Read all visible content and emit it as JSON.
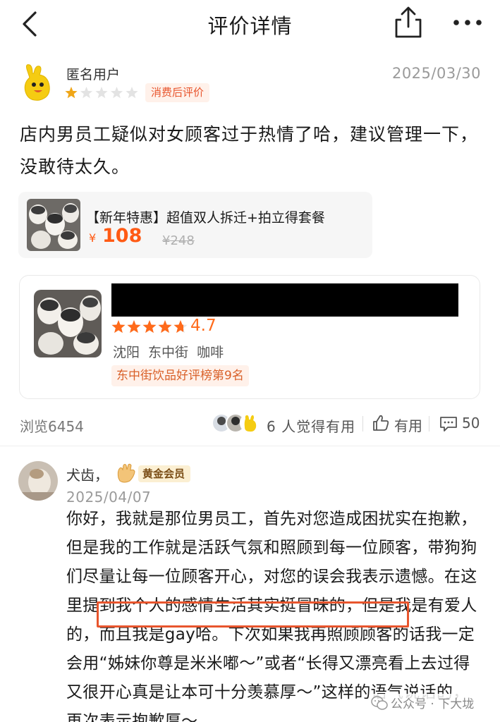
{
  "header": {
    "title": "评价详情",
    "back_icon": "chevron-left-icon",
    "share_icon": "share-icon",
    "more_icon": "more-icon"
  },
  "review": {
    "user_name": "匿名用户",
    "date": "2025/03/30",
    "rating": 1,
    "rating_max": 5,
    "badge": "消费后评价",
    "text": "店内男员工疑似对女顾客过于热情了哈，建议管理一下，没敢待太久。"
  },
  "deal": {
    "title": "【新年特惠】超值双人拆迁+拍立得套餐",
    "currency": "¥",
    "price": "108",
    "original_price": "¥248"
  },
  "shop": {
    "rating_text": "4.7",
    "rating": 4.7,
    "location": "沈阳 东中街 咖啡",
    "rank": "东中街饮品好评榜第9名"
  },
  "stats": {
    "views": "浏览6454",
    "helpful": "6 人觉得有用",
    "useful_label": "有用",
    "comments": "50"
  },
  "reply": {
    "name": "犬齿，",
    "badge": "黄金会员",
    "date": "2025/04/07",
    "text_before": "你好，我就是那位男员工，首先对您造成困扰实在抱歉，但是我的工作就是活跃气氛和照顾到每一位顾客，带狗狗们尽量让每一位顾客开心，对您的误会我表示遗憾。在这里提到我个人的感情生活其实挺冒昧的，",
    "text_highlight": "但是我是有爱人的，而且我是gay哈。",
    "text_after": "下次如果我再照顾顾客的话我一定会用“姊妹你尊是米米嘟～”或者“长得又漂亮看上去过得又很开心真是让本可十分羡慕厚～”这样的语气说话的，再次表示抱歉厚～"
  },
  "watermark": "公众号 · 下大垅",
  "colors": {
    "accent_orange": "#ff5a14",
    "highlight_border": "#e8552d",
    "badge_bg": "#fff1ea"
  }
}
